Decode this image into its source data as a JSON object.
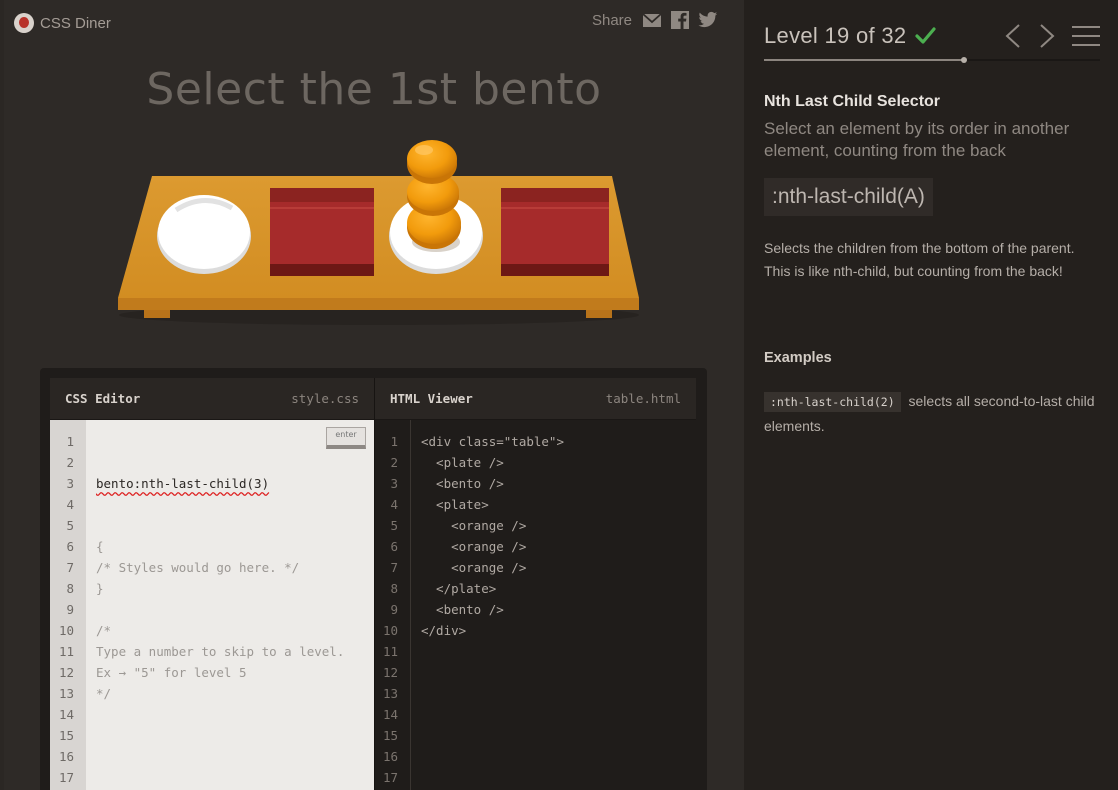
{
  "app": {
    "name": "CSS Diner",
    "share_label": "Share",
    "share_icons": [
      "mail-icon",
      "facebook-icon",
      "twitter-icon"
    ]
  },
  "game": {
    "instruction": "Select the 1st bento",
    "table_items": [
      "plate",
      "bento",
      "plate-with-oranges",
      "bento"
    ]
  },
  "css_editor": {
    "title": "CSS Editor",
    "file": "style.css",
    "input_value": "bento:nth-last-child(3)",
    "enter_label": "enter",
    "lines": [
      "{",
      "/* Styles would go here. */",
      "}",
      "",
      "/*",
      "Type a number to skip to a level.",
      "Ex → \"5\" for level 5",
      "*/"
    ],
    "line_numbers": [
      "1",
      "2",
      "3",
      "4",
      "5",
      "6",
      "7",
      "8",
      "9",
      "10",
      "11",
      "12",
      "13",
      "14",
      "15",
      "16",
      "17"
    ]
  },
  "html_viewer": {
    "title": "HTML Viewer",
    "file": "table.html",
    "lines": [
      "<div class=\"table\">",
      "  <plate />",
      "  <bento />",
      "  <plate>",
      "    <orange />",
      "    <orange />",
      "    <orange />",
      "  </plate>",
      "  <bento />",
      "</div>"
    ],
    "line_numbers": [
      "1",
      "2",
      "3",
      "4",
      "5",
      "6",
      "7",
      "8",
      "9",
      "10",
      "11",
      "12",
      "13",
      "14",
      "15",
      "16",
      "17"
    ]
  },
  "sidebar": {
    "level_text": "Level 19 of 32",
    "level_current": 19,
    "level_total": 32,
    "completed": true,
    "selector_name": "Nth Last Child Selector",
    "selector_description": "Select an element by its order in another element, counting from the back",
    "syntax": ":nth-last-child(A)",
    "hint": "Selects the children from the bottom of the parent. This is like nth-child, but counting from the back!",
    "examples_title": "Examples",
    "example_code": ":nth-last-child(2)",
    "example_text": "selects all second-to-last child elements."
  },
  "colors": {
    "accent_check": "#4caf50",
    "table_wood": "#d9952a",
    "bento_red": "#a62b2b",
    "orange": "#f29b0c"
  }
}
